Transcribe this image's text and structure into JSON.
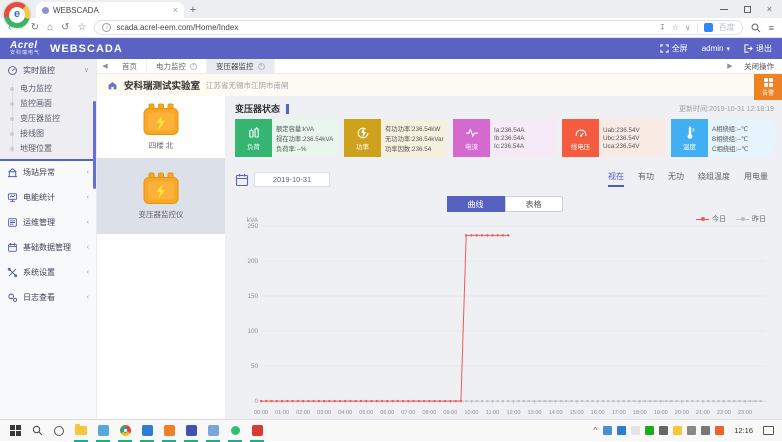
{
  "colors": {
    "accent": "#5a63c4",
    "alarm_orange": "#ef8324",
    "today_red": "#f25a5a",
    "yesterday_gray": "#b9bfc9"
  },
  "browser": {
    "tab_title": "WEBSCADA",
    "url": "scada.acrel-eem.com/Home/Index",
    "search_engine": "百度"
  },
  "header": {
    "logo_text": "Acrel",
    "logo_sub": "安科瑞电气",
    "app_title": "WEBSCADA",
    "fullscreen_label": "全屏",
    "user_label": "admin",
    "logout_label": "退出"
  },
  "sidebar": {
    "items": [
      {
        "icon": "gauge-icon",
        "label": "实时监控",
        "expanded": true,
        "children": [
          "电力监控",
          "监控画面",
          "变压器监控",
          "接线图",
          "地理位置"
        ]
      },
      {
        "icon": "station-icon",
        "label": "场站异常"
      },
      {
        "icon": "energy-icon",
        "label": "电能统计"
      },
      {
        "icon": "ops-icon",
        "label": "运维管理"
      },
      {
        "icon": "database-icon",
        "label": "基础数据管理"
      },
      {
        "icon": "settings-icon",
        "label": "系统设置"
      },
      {
        "icon": "log-icon",
        "label": "日志查看"
      }
    ]
  },
  "tabbar": {
    "items": [
      {
        "label": "首页",
        "closable": false,
        "active": false
      },
      {
        "label": "电力监控",
        "closable": true,
        "active": false
      },
      {
        "label": "变压器监控",
        "closable": true,
        "active": true
      }
    ],
    "close_ops_label": "关闭操作"
  },
  "station": {
    "name": "安科瑞测试实验室",
    "location": "江苏省无锡市江阴市南闸",
    "alarm_label": "告警"
  },
  "devices": {
    "items": [
      {
        "name": "四楼 北",
        "selected": false
      },
      {
        "name": "变压器监控仪",
        "selected": true
      }
    ]
  },
  "status": {
    "title": "变压器状态",
    "update_time": "更新时间:2019-10-31 12:18:19",
    "cards": [
      {
        "icon": "load-icon",
        "label": "负荷",
        "color": "#35b571",
        "bg": "#e8f6ee",
        "lines": [
          "额定容量:kVA",
          "视在功率:236.54kVA",
          "负荷率:--%"
        ]
      },
      {
        "icon": "power-icon",
        "label": "功率",
        "color": "#cfa21d",
        "bg": "#f6f1de",
        "lines": [
          "有功功率:236.54kW",
          "无功功率:236.54kVar",
          "功率因数:236.54"
        ]
      },
      {
        "icon": "current-icon",
        "label": "电流",
        "color": "#d46ad0",
        "bg": "#f5eaf5",
        "lines": [
          "Ia:236.54A",
          "Ib:236.54A",
          "Ic:236.54A"
        ]
      },
      {
        "icon": "voltage-icon",
        "label": "线电压",
        "color": "#f55b3e",
        "bg": "#faeae4",
        "lines": [
          "Uab:236.54V",
          "Ubc:236.54V",
          "Uca:236.54V"
        ]
      },
      {
        "icon": "temperature-icon",
        "label": "温度",
        "color": "#41aff2",
        "bg": "#e6f4fd",
        "lines": [
          "A相绕组:--℃",
          "B相绕组:--℃",
          "C相绕组:--℃"
        ]
      }
    ]
  },
  "controls": {
    "date": "2019-10-31",
    "views": [
      {
        "label": "曲线",
        "active": true
      },
      {
        "label": "表格",
        "active": false
      }
    ],
    "metrics": [
      {
        "label": "视在",
        "active": true
      },
      {
        "label": "有功",
        "active": false
      },
      {
        "label": "无功",
        "active": false
      },
      {
        "label": "绕组温度",
        "active": false
      },
      {
        "label": "用电量",
        "active": false
      }
    ]
  },
  "chart_data": {
    "type": "line",
    "ylabel": "kVA",
    "ylim": [
      0,
      250
    ],
    "yticks": [
      0,
      50,
      100,
      150,
      200,
      250
    ],
    "x_labels": [
      "00:00",
      "01:00",
      "02:00",
      "03:00",
      "04:00",
      "05:00",
      "06:00",
      "07:00",
      "08:00",
      "09:00",
      "10:00",
      "11:00",
      "12:00",
      "13:00",
      "14:00",
      "15:00",
      "16:00",
      "17:00",
      "18:00",
      "19:00",
      "20:00",
      "21:00",
      "22:00",
      "23:00"
    ],
    "marker_interval_hours": 0.25,
    "legend_position": "top-right",
    "grid": true,
    "series": [
      {
        "name": "今日",
        "color": "#f25a5a",
        "style": "solid",
        "points": [
          [
            0,
            0
          ],
          [
            9.5,
            0
          ],
          [
            9.75,
            236.54
          ],
          [
            11.75,
            236.54
          ]
        ]
      },
      {
        "name": "昨日",
        "color": "#b9bfc9",
        "style": "dashed",
        "points": [
          [
            0,
            0
          ],
          [
            23.75,
            0
          ]
        ]
      }
    ]
  },
  "taskbar": {
    "time": "12:16",
    "apps": [
      {
        "name": "file-explorer",
        "type": "folder",
        "color": "#f8c63d",
        "running": true
      },
      {
        "name": "display-app",
        "type": "square",
        "color": "#58a6dd",
        "running": true
      },
      {
        "name": "browser-app",
        "type": "chrome",
        "color": "",
        "running": true
      },
      {
        "name": "app-blue",
        "type": "square",
        "color": "#2e7cd6",
        "running": true
      },
      {
        "name": "app-orange",
        "type": "square",
        "color": "#f07f28",
        "running": true
      },
      {
        "name": "app-indigo",
        "type": "square",
        "color": "#4053b4",
        "running": true
      },
      {
        "name": "app-lightblue",
        "type": "square",
        "color": "#7aa7d9",
        "running": true
      },
      {
        "name": "app-green",
        "type": "dot",
        "color": "#2fbf71",
        "running": true
      },
      {
        "name": "app-red",
        "type": "square",
        "color": "#d93b30",
        "running": true
      }
    ],
    "tray": [
      {
        "name": "shield-icon",
        "color": "#4a90d2"
      },
      {
        "name": "app-blue-icon",
        "color": "#2d7dd2"
      },
      {
        "name": "doc-icon",
        "color": "#e4e4e4"
      },
      {
        "name": "wechat-icon",
        "color": "#1aad19"
      },
      {
        "name": "audio-icon",
        "color": "#666666"
      },
      {
        "name": "folder-icon",
        "color": "#f8c63d"
      },
      {
        "name": "display-icon",
        "color": "#888888"
      },
      {
        "name": "network-icon",
        "color": "#777777"
      },
      {
        "name": "security-icon",
        "color": "#f0622a"
      }
    ]
  }
}
